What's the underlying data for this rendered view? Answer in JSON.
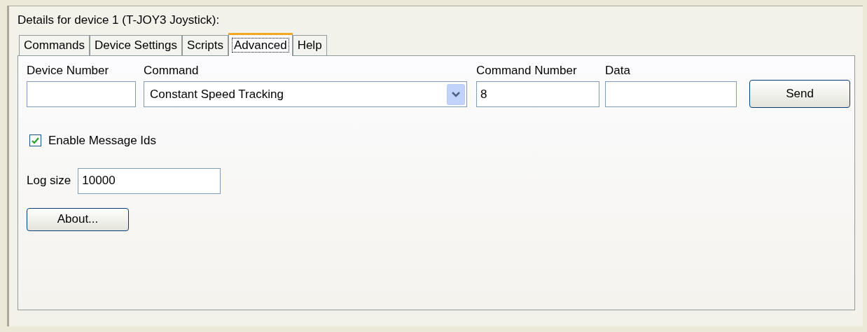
{
  "group": {
    "title": "Details for device 1 (T-JOY3 Joystick):"
  },
  "tabs": [
    {
      "label": "Commands",
      "selected": false
    },
    {
      "label": "Device Settings",
      "selected": false
    },
    {
      "label": "Scripts",
      "selected": false
    },
    {
      "label": "Advanced",
      "selected": true
    },
    {
      "label": "Help",
      "selected": false
    }
  ],
  "fields": {
    "device_number": {
      "label": "Device Number"
    },
    "command": {
      "label": "Command",
      "value": "Constant Speed Tracking"
    },
    "command_number": {
      "label": "Command Number",
      "value": "8"
    },
    "data": {
      "label": "Data"
    }
  },
  "send_button": "Send",
  "enable_message_ids": {
    "label": "Enable Message Ids",
    "checked": true
  },
  "log_size": {
    "label": "Log size",
    "value": "10000"
  },
  "about_button": "About..."
}
